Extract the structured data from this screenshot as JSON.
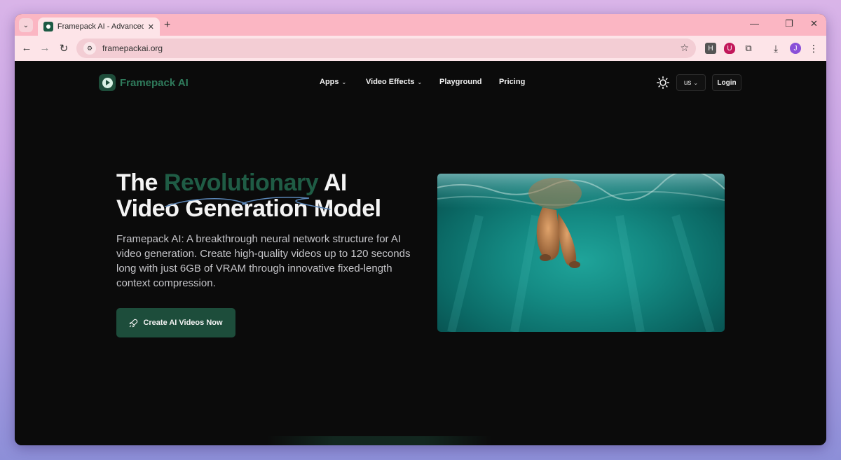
{
  "browser": {
    "tab_title": "Framepack AI - Advanced Neur",
    "url": "framepackai.org",
    "profile_initial": "J",
    "ext_h_label": "H"
  },
  "site": {
    "brand": "Framepack AI",
    "nav": [
      {
        "label": "Apps",
        "has_dropdown": true
      },
      {
        "label": "Video Effects",
        "has_dropdown": true
      },
      {
        "label": "Playground",
        "has_dropdown": false
      },
      {
        "label": "Pricing",
        "has_dropdown": false
      }
    ],
    "language": "us",
    "login_label": "Login"
  },
  "hero": {
    "title_word1": "The",
    "title_accent": "Revolutionary",
    "title_word2": "AI",
    "title_line2": "Video Generation Model",
    "description": "Framepack AI: A breakthrough neural network structure for AI video generation. Create high-quality videos up to 120 seconds long with just 6GB of VRAM through innovative fixed-length context compression.",
    "cta_label": "Create AI Videos Now"
  },
  "colors": {
    "accent_green": "#1f5c45",
    "tab_bar": "#fbb6c3",
    "page_bg": "#0b0b0b"
  }
}
